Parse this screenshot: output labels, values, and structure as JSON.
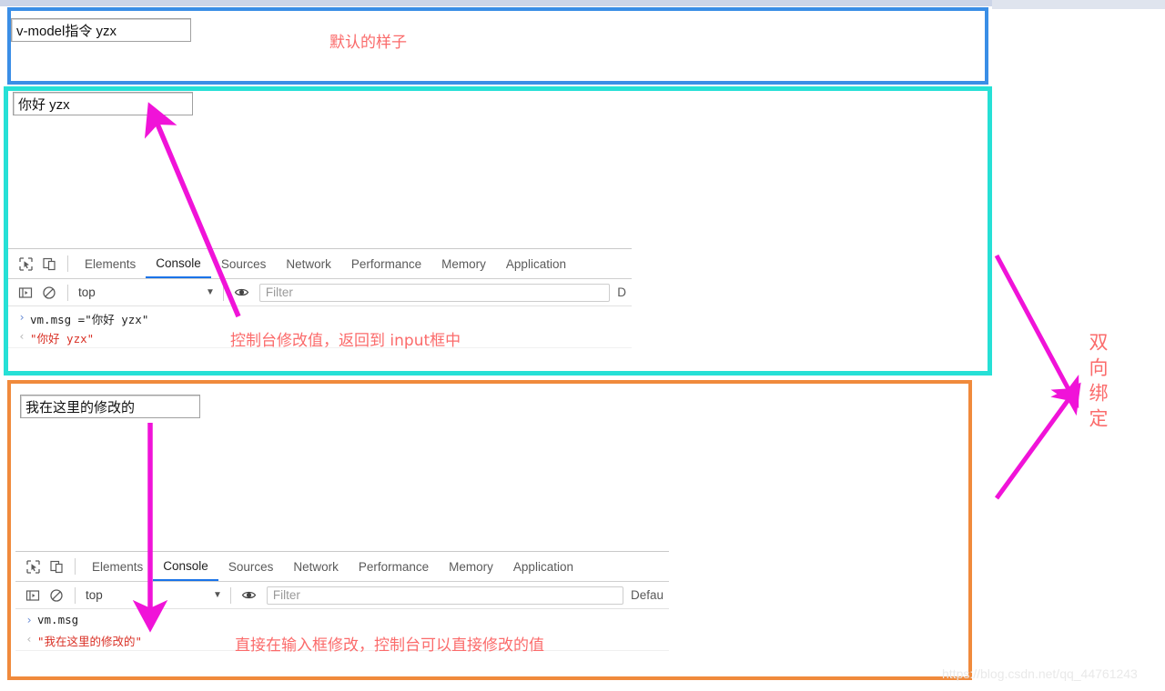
{
  "page": {
    "watermark": "https://blog.csdn.net/qq_44761243"
  },
  "sections": {
    "default_demo": {
      "border_color": "#3a8ee6",
      "input_value": "v-model指令 yzx",
      "note": "默认的样子"
    },
    "console_edit_demo": {
      "border_color": "#26e0d6",
      "input_value": "你好 yzx",
      "note": "控制台修改值，返回到 input框中"
    },
    "input_edit_demo": {
      "border_color": "#f08a3c",
      "input_value": "我在这里的修改的",
      "note": "直接在输入框修改，控制台可以直接修改的值"
    }
  },
  "binding_label": "双向绑定",
  "devtools_1": {
    "icons": [
      "inspect-icon",
      "device-toggle-icon"
    ],
    "tabs": [
      {
        "label": "Elements",
        "active": false
      },
      {
        "label": "Console",
        "active": true
      },
      {
        "label": "Sources",
        "active": false
      },
      {
        "label": "Network",
        "active": false
      },
      {
        "label": "Performance",
        "active": false
      },
      {
        "label": "Memory",
        "active": false
      },
      {
        "label": "Application",
        "active": false
      }
    ],
    "toolbar": {
      "context": "top",
      "filter_placeholder": "Filter",
      "levels": "D"
    },
    "console_lines": [
      {
        "type": "input",
        "marker": "›",
        "text": "vm.msg =\"你好 yzx\""
      },
      {
        "type": "output",
        "marker": "‹",
        "text": "\"你好 yzx\""
      }
    ]
  },
  "devtools_2": {
    "icons": [
      "inspect-icon",
      "device-toggle-icon"
    ],
    "tabs": [
      {
        "label": "Elements",
        "active": false
      },
      {
        "label": "Console",
        "active": true
      },
      {
        "label": "Sources",
        "active": false
      },
      {
        "label": "Network",
        "active": false
      },
      {
        "label": "Performance",
        "active": false
      },
      {
        "label": "Memory",
        "active": false
      },
      {
        "label": "Application",
        "active": false
      }
    ],
    "toolbar": {
      "context": "top",
      "filter_placeholder": "Filter",
      "levels": "Defau"
    },
    "console_lines": [
      {
        "type": "input",
        "marker": "›",
        "text": "vm.msg"
      },
      {
        "type": "output",
        "marker": "‹",
        "text": "\"我在这里的修改的\""
      }
    ]
  }
}
